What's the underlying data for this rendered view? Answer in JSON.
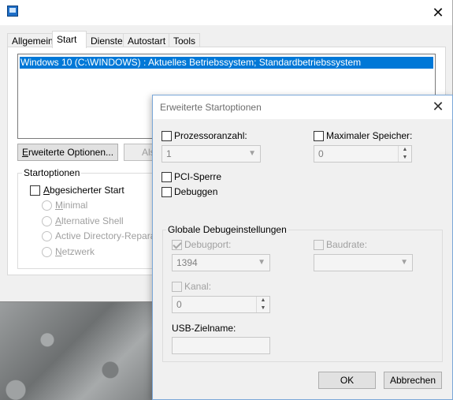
{
  "main_window": {
    "tabs": [
      "Allgemein",
      "Start",
      "Dienste",
      "Autostart",
      "Tools"
    ],
    "os_entry": "Windows 10 (C:\\WINDOWS) : Aktuelles Betriebssystem; Standardbetriebssystem",
    "advanced_button": "Erweiterte Optionen...",
    "advanced_button_mnemonic": "E",
    "advanced_button_rest": "rweiterte Optionen...",
    "default_button_partial": "Als",
    "boot_options_label": "Startoptionen",
    "safe_boot": {
      "mnemonic": "A",
      "rest": "bgesicherter Start"
    },
    "radios": [
      {
        "mnemonic": "M",
        "rest": "inimal"
      },
      {
        "mnemonic": "A",
        "rest": "lternative Shell"
      },
      {
        "mnemonic": "",
        "rest": "Active Directory-Reparatu"
      },
      {
        "mnemonic": "N",
        "rest": "etzwerk"
      }
    ]
  },
  "dialog": {
    "title": "Erweiterte Startoptionen",
    "cpu_count_label": "Prozessoranzahl:",
    "cpu_count_value": "1",
    "max_memory_label": "Maximaler Speicher:",
    "max_memory_value": "0",
    "pci_lock_label": "PCI-Sperre",
    "debug_label": "Debuggen",
    "global_debug_label": "Globale Debugeinstellungen",
    "debug_port_label": "Debugport:",
    "debug_port_value": "1394",
    "baud_rate_label": "Baudrate:",
    "baud_rate_value": "",
    "channel_label": "Kanal:",
    "channel_value": "0",
    "usb_target_label": "USB-Zielname:",
    "usb_target_value": "",
    "ok_label": "OK",
    "cancel_label": "Abbrechen"
  },
  "colors": {
    "selection": "#0078d7",
    "window_bg": "#f0f0f0",
    "disabled_text": "#a0a0a0"
  }
}
